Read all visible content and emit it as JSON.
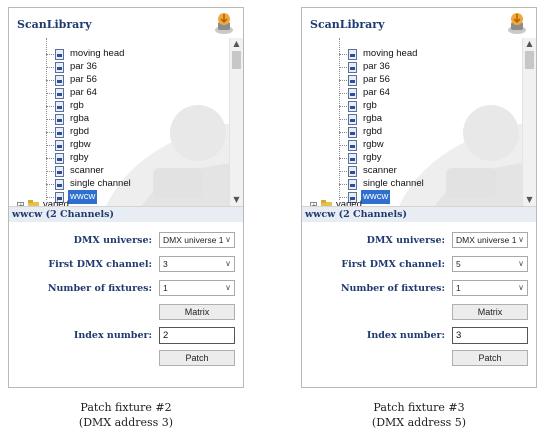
{
  "colors": {
    "title": "#1f3a70",
    "selection": "#2f6fcf",
    "section_bg": "#e8ecf3"
  },
  "panels": [
    {
      "title": "ScanLibrary",
      "tree_items": [
        "moving head",
        "par 36",
        "par 56",
        "par 64",
        "rgb",
        "rgba",
        "rgbd",
        "rgbw",
        "rgby",
        "scanner",
        "single channel",
        "wwcw"
      ],
      "selected_item": "wwcw",
      "partial_item": "varied",
      "section_header": "wwcw (2 Channels)",
      "fields": {
        "dmx_universe_label": "DMX universe:",
        "dmx_universe_value": "DMX universe 1",
        "first_channel_label": "First DMX channel:",
        "first_channel_value": "3",
        "fixtures_label": "Number of fixtures:",
        "fixtures_value": "1",
        "matrix_button": "Matrix",
        "index_label": "Index number:",
        "index_value": "2",
        "patch_button": "Patch"
      },
      "caption_line1": "Patch fixture #2",
      "caption_line2": "(DMX address 3)"
    },
    {
      "title": "ScanLibrary",
      "tree_items": [
        "moving head",
        "par 36",
        "par 56",
        "par 64",
        "rgb",
        "rgba",
        "rgbd",
        "rgbw",
        "rgby",
        "scanner",
        "single channel",
        "wwcw"
      ],
      "selected_item": "wwcw",
      "partial_item": "varied",
      "section_header": "wwcw (2 Channels)",
      "fields": {
        "dmx_universe_label": "DMX universe:",
        "dmx_universe_value": "DMX universe 1",
        "first_channel_label": "First DMX channel:",
        "first_channel_value": "5",
        "fixtures_label": "Number of fixtures:",
        "fixtures_value": "1",
        "matrix_button": "Matrix",
        "index_label": "Index number:",
        "index_value": "3",
        "patch_button": "Patch"
      },
      "caption_line1": "Patch fixture #3",
      "caption_line2": "(DMX address 5)"
    }
  ]
}
